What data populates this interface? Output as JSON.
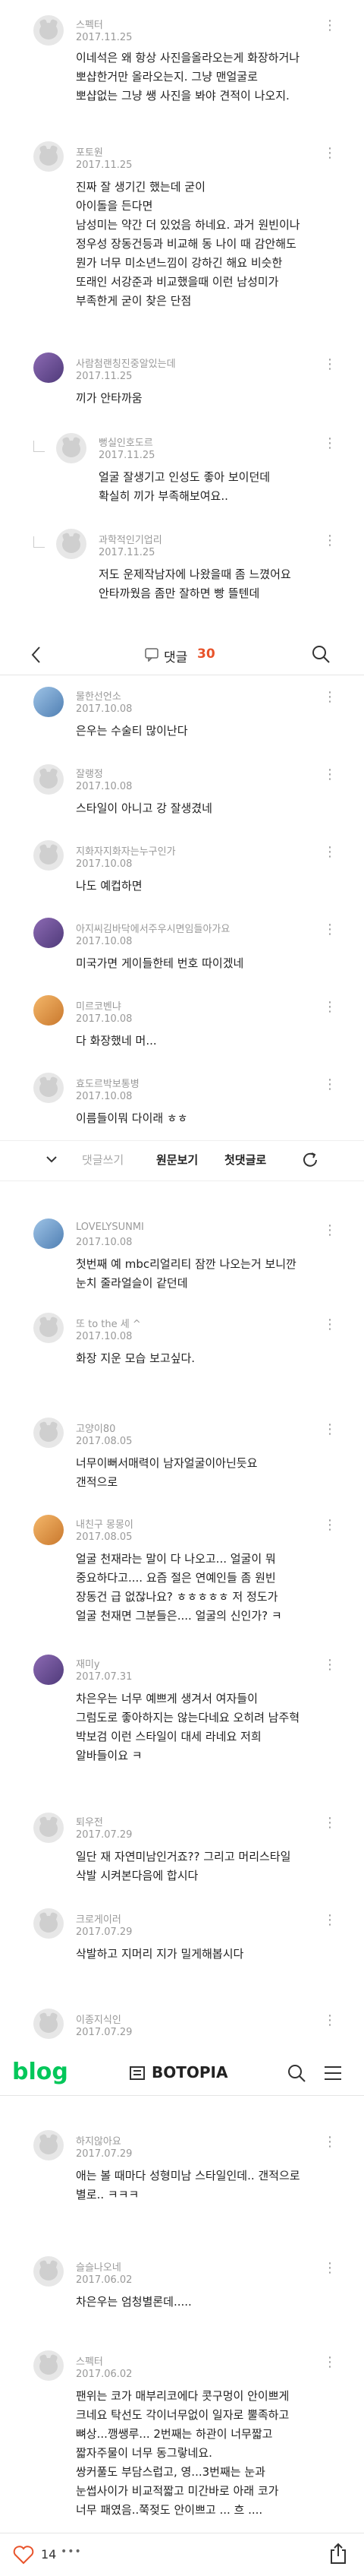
{
  "comments_top": [
    {
      "nick": "스펙터",
      "date": "2017.11.25",
      "body": "이네석은 왜 항상 사진을올라오는게 화장하거나\n뽀샵한거만 올라오는지. 그냥 맨얼굴로\n뽀샵없는 그냥 쌩 사진을 봐야 견적이 나오지."
    },
    {
      "nick": "포토원",
      "date": "2017.11.25",
      "body": "진짜 잘 생기긴 했는데 굳이\n아이돌을 든다면\n남성미는 약간 더 있었음 하네요. 과거 원빈이나\n정우성 장동건등과 비교해 동 나이 때 감안해도\n뭔가 너무 미소년느낌이 강하긴 해요 비슷한\n또래인 서강준과 비교했을때 이런 남성미가\n부족한게 굳이 찾은 단점"
    },
    {
      "nick": "사람첨랜칭진중알있는데",
      "date": "2017.11.25",
      "body": "끼가 안타까움"
    }
  ],
  "replies_top": [
    {
      "nick": "뻥실인호도르",
      "date": "2017.11.25",
      "body": "얼굴 잘생기고 인성도 좋아 보이던데\n확실히 끼가 부족해보여요.."
    },
    {
      "nick": "과학적인기업리",
      "date": "2017.11.25",
      "body": "저도 운제작남자에 나왔을때 좀 느꼈어요\n안타까웠음 좀만 잘하면 빵 뜰텐데"
    }
  ],
  "nav": {
    "back_label": "<",
    "comment_label": "댓글",
    "comment_count": "30",
    "search_icon": "search"
  },
  "comments_mid": [
    {
      "nick": "물한선언소",
      "date": "2017.10.08",
      "body": "은우는 수술티 많이난다"
    },
    {
      "nick": "잘랭정",
      "date": "2017.10.08",
      "body": "스타일이 아니고 강 잘생겼네"
    },
    {
      "nick": "지화자지화자는누구인가",
      "date": "2017.10.08",
      "body": "나도 예컵하면"
    },
    {
      "nick": "아지씨김바닥에서주우시면임들아가요",
      "date": "2017.10.08",
      "body": "미국가면 게이들한테 번호 따이겠네"
    },
    {
      "nick": "미르코벤냐",
      "date": "2017.10.08",
      "body": "다 화장했네 머..."
    },
    {
      "nick": "효도르박보통병",
      "date": "2017.10.08",
      "body": "이름들이뭐 다이래 ㅎㅎ"
    }
  ],
  "toolbar": {
    "write_label": "댓글쓰기",
    "original_label": "원문보기",
    "first_label": "첫댓글로"
  },
  "comments_low": [
    {
      "nick": "LOVELYSUNMI",
      "date": "2017.10.08",
      "body": "첫번째 예 mbc리얼리티 잠깐 나오는거 보니깐\n눈치 줄라얼슬이 같던데"
    },
    {
      "nick": "또 to the 세 ^",
      "date": "2017.10.08",
      "body": "화장 지운 모습 보고싶다."
    },
    {
      "nick": "고양이80",
      "date": "2017.08.05",
      "body": "너무이뻐서매력이 남자얼굴이아닌듯요\n갠적으로"
    },
    {
      "nick": "내친구 몽몽이",
      "date": "2017.08.05",
      "body": "얼굴 천재라는 말이 다 나오고... 얼굴이 뭐\n중요하다고.... 요즘 절은 연예인들 좀 원빈\n장동건 급 없잖나요? ㅎㅎㅎㅎㅎ 저 정도가\n얼굴 천재면 그분들은.... 얼굴의 신인가? ㅋ"
    },
    {
      "nick": "재미y",
      "date": "2017.07.31",
      "body": "차은우는 너무 예쁘게 생겨서 여자들이\n그럼도로 좋아하지는 않는다네요 오히려 남주혁\n박보검 이런 스타일이 대세 라네요 저희\n알바들이요 ㅋ"
    },
    {
      "nick": "퇴우전",
      "date": "2017.07.29",
      "body": "일단 재 자연미남인거죠?? 그리고 머리스타일\n삭발 시켜본다음에 합시다"
    },
    {
      "nick": "크로게이러",
      "date": "2017.07.29",
      "body": "삭발하고 지머리 지가 밀게해봅시다"
    },
    {
      "nick": "이종지식인",
      "date": "2017.07.29",
      "body": ""
    }
  ],
  "blog": {
    "logo": "blog",
    "title": "BOTOPIA"
  },
  "comments_bottom": [
    {
      "nick": "하지않아요",
      "date": "2017.07.29",
      "body": "애는 볼 때마다 성형미남 스타일인데.. 갠적으로\n별로.. ㅋㅋㅋ"
    },
    {
      "nick": "슬슬나오네",
      "date": "2017.06.02",
      "body": "차은우는 엄청별론데....."
    },
    {
      "nick": "스펙터",
      "date": "2017.06.02",
      "body": "팬위는 코가 매부리코에다 콧구멍이 안이쁘게\n크네요 탁선도 각이너무없이 일자로 뿔족하고\n뼈상...깽쌩루... 2번째는 하관이 너무짧고\n짧자주물이 너무 동그랗네요.\n쌍커풀도 부담스럽고, 영...3번째는 눈과\n눈썹사이가 비교적짧고 미간바로 아래 코가\n너무 패였음..쭉젖도 안이쁘고 ... 흐 ...."
    }
  ],
  "bottombar": {
    "like_count": "14",
    "dots": "•••"
  }
}
